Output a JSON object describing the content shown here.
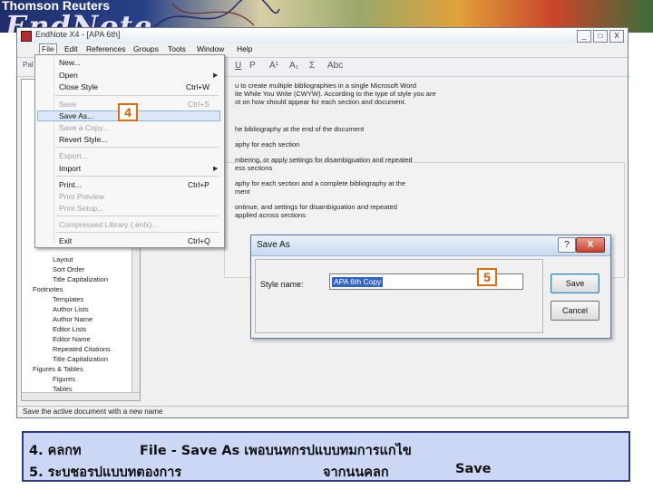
{
  "banner": {
    "brand": "Thomson Reuters",
    "logo": "EndNote"
  },
  "window": {
    "title": "EndNote X4 - [APA 6th]",
    "buttons": [
      "_",
      "□",
      "X"
    ]
  },
  "menubar": [
    "File",
    "Edit",
    "References",
    "Groups",
    "Tools",
    "Window",
    "Help"
  ],
  "toolbar": {
    "palette_label": "Pal",
    "icons": [
      "U",
      "P",
      "A¹",
      "A₁",
      "Σ",
      "Abc"
    ]
  },
  "left_tree": [
    "Layout",
    "Sort Order",
    "Title Capitalization",
    "Footnotes",
    "Templates",
    "Author Lists",
    "Author Name",
    "Editor Lists",
    "Editor Name",
    "Repeated Citations",
    "Title Capitalization",
    "Figures & Tables",
    "Figures",
    "Tables"
  ],
  "right_content": {
    "intro": [
      "u to create multiple bibliographies in a single Microsoft Word",
      "ite While You Write (CWYW). According to the type of style you are",
      "ot on how should appear for each section and document."
    ],
    "options": [
      "he bibliography at the end of the document",
      "aphy for each section",
      "mbering, or apply settings for disambiguation and repeated",
      "ess sections",
      "aphy for each section and a complete bibliography at the",
      "ment",
      "ontinue, and settings for disambiguation and repeated",
      "applied across sections"
    ]
  },
  "status_text": "Save the active document with a new name",
  "file_menu": {
    "items": [
      {
        "label": "New...",
        "shortcut": "",
        "disabled": false,
        "submenu": false
      },
      {
        "label": "Open",
        "shortcut": "",
        "disabled": false,
        "submenu": true
      },
      {
        "label": "Close Style",
        "shortcut": "Ctrl+W",
        "disabled": false,
        "submenu": false
      },
      {
        "label": "Save",
        "shortcut": "Ctrl+S",
        "disabled": true,
        "submenu": false
      },
      {
        "label": "Save As...",
        "shortcut": "",
        "disabled": false,
        "submenu": false,
        "highlighted": true
      },
      {
        "label": "Save a Copy...",
        "shortcut": "",
        "disabled": true,
        "submenu": false
      },
      {
        "label": "Revert Style...",
        "shortcut": "",
        "disabled": false,
        "submenu": false
      },
      {
        "label": "Export...",
        "shortcut": "",
        "disabled": true,
        "submenu": false
      },
      {
        "label": "Import",
        "shortcut": "",
        "disabled": false,
        "submenu": true
      },
      {
        "label": "Print...",
        "shortcut": "Ctrl+P",
        "disabled": false,
        "submenu": false
      },
      {
        "label": "Print Preview",
        "shortcut": "",
        "disabled": true,
        "submenu": false
      },
      {
        "label": "Print Setup...",
        "shortcut": "",
        "disabled": true,
        "submenu": false
      },
      {
        "label": "Compressed Library (.enlx)...",
        "shortcut": "",
        "disabled": true,
        "submenu": false
      },
      {
        "label": "Exit",
        "shortcut": "Ctrl+Q",
        "disabled": false,
        "submenu": false
      }
    ]
  },
  "badges": {
    "step4": "4",
    "step5": "5"
  },
  "save_as_dialog": {
    "title": "Save As",
    "help": "?",
    "close": "X",
    "style_name_label": "Style name:",
    "style_name_value": "APA 6th Copy",
    "save_button": "Save",
    "cancel_button": "Cancel"
  },
  "instructions": {
    "line1_a": "4. คลกท",
    "line1_b": "File - Save As เพอบนทกรปแบบทมการแกไข",
    "line2_a": "5. ระบชอรปแบบทตองการ",
    "line2_b": "จากนนคลก",
    "line2_c": "Save"
  }
}
